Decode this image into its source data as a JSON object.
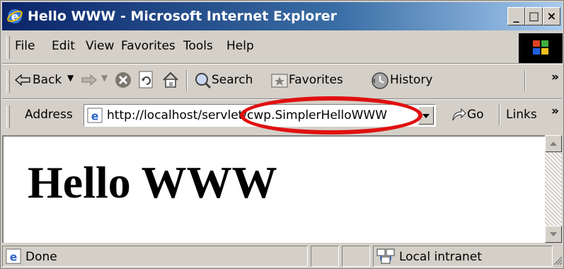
{
  "window": {
    "title": "Hello WWW - Microsoft Internet Explorer",
    "controls": [
      "_",
      "□",
      "×"
    ]
  },
  "menu": {
    "items": [
      "File",
      "Edit",
      "View",
      "Favorites",
      "Tools",
      "Help"
    ]
  },
  "toolbar": {
    "back_label": "Back",
    "search_label": "Search",
    "favorites_label": "Favorites",
    "history_label": "History",
    "more": "»"
  },
  "address": {
    "label": "Address",
    "url": "http://localhost/servlet/cwp.SimplerHelloWWW",
    "go_label": "Go",
    "links_label": "Links",
    "more": "»"
  },
  "page": {
    "heading": "Hello WWW"
  },
  "status": {
    "text": "Done",
    "zone": "Local intranet"
  },
  "colors": {
    "highlight": "#e01010",
    "titlebar_start": "#0a246a",
    "titlebar_end": "#a6caf0"
  }
}
